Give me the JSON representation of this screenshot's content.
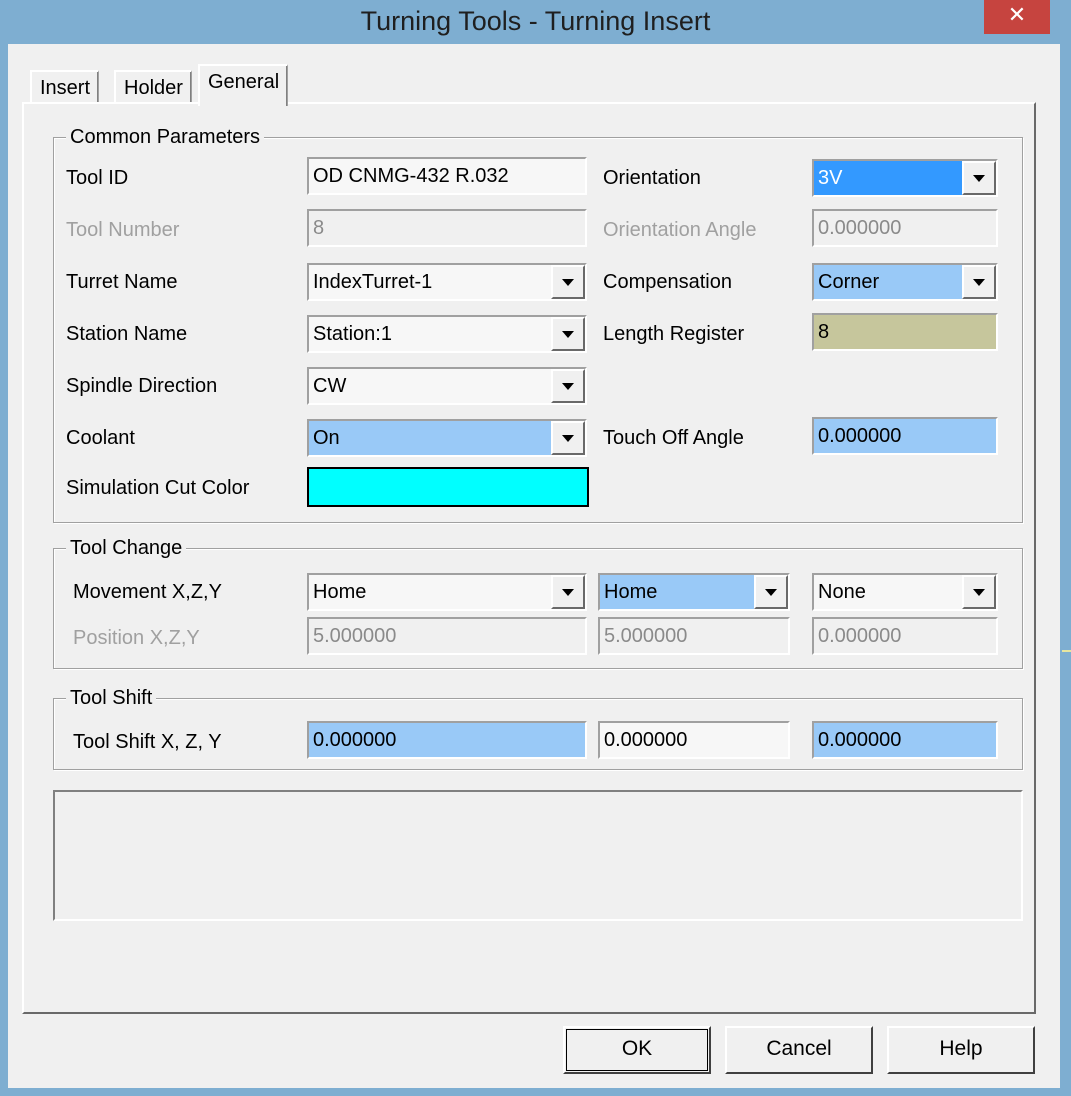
{
  "window": {
    "title": "Turning Tools - Turning Insert",
    "close_label": "✕"
  },
  "tabs": [
    {
      "label": "Insert",
      "active": false
    },
    {
      "label": "Holder",
      "active": false
    },
    {
      "label": "General",
      "active": true
    }
  ],
  "common": {
    "legend": "Common Parameters",
    "tool_id": {
      "label": "Tool ID",
      "value": "OD CNMG-432 R.032"
    },
    "tool_number": {
      "label": "Tool Number",
      "value": "8"
    },
    "turret_name": {
      "label": "Turret Name",
      "value": "IndexTurret-1"
    },
    "station_name": {
      "label": "Station Name",
      "value": "Station:1"
    },
    "spindle_direction": {
      "label": "Spindle Direction",
      "value": "CW"
    },
    "coolant": {
      "label": "Coolant",
      "value": "On"
    },
    "sim_cut_color": {
      "label": "Simulation Cut Color",
      "color": "#00ffff"
    },
    "orientation": {
      "label": "Orientation",
      "value": "3V"
    },
    "orientation_angle": {
      "label": "Orientation Angle",
      "value": "0.000000"
    },
    "compensation": {
      "label": "Compensation",
      "value": "Corner"
    },
    "length_register": {
      "label": "Length Register",
      "value": "8"
    },
    "touch_off_angle": {
      "label": "Touch Off Angle",
      "value": "0.000000"
    }
  },
  "tool_change": {
    "legend": "Tool Change",
    "movement_label": "Movement X,Z,Y",
    "movement": [
      "Home",
      "Home",
      "None"
    ],
    "position_label": "Position X,Z,Y",
    "position": [
      "5.000000",
      "5.000000",
      "0.000000"
    ]
  },
  "tool_shift": {
    "legend": "Tool Shift",
    "label": "Tool Shift X, Z, Y",
    "values": [
      "0.000000",
      "0.000000",
      "0.000000"
    ]
  },
  "buttons": {
    "ok": "OK",
    "cancel": "Cancel",
    "help": "Help"
  },
  "colors": {
    "titlebar": "#7eaed1",
    "close": "#c6443f",
    "field_blue": "#99c9f7",
    "selected": "#3399ff",
    "length_register_bg": "#c6c69c",
    "sim_color": "#00ffff"
  }
}
